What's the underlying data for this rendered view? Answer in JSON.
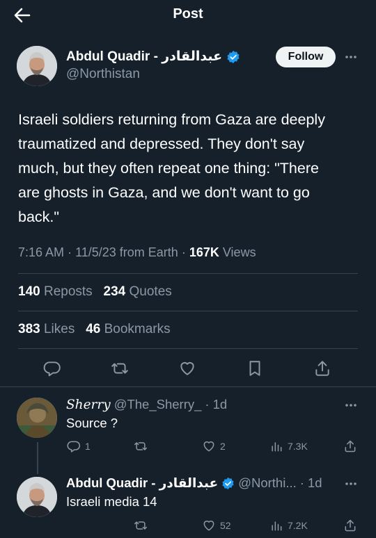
{
  "header": {
    "title": "Post"
  },
  "post": {
    "author_name": "Abdul Quadir - عبدالقادر",
    "author_handle": "@Northistan",
    "follow_label": "Follow",
    "text_lines": [
      "Israeli soldiers returning from Gaza are deeply",
      "traumatized and depressed. They don't say",
      "much, but they often repeat one thing: \"There",
      "are ghosts in Gaza, and we don't want to go",
      "back.\""
    ],
    "time": "7:16 AM",
    "date": "11/5/23 from Earth",
    "views_count": "167K",
    "views_label": "Views",
    "reposts_count": "140",
    "reposts_label": "Reposts",
    "quotes_count": "234",
    "quotes_label": "Quotes",
    "likes_count": "383",
    "likes_label": "Likes",
    "bookmarks_count": "46",
    "bookmarks_label": "Bookmarks"
  },
  "replies": [
    {
      "name": "Sherry",
      "handle": "@The_Sherry_",
      "age": "1d",
      "text": "Source ?",
      "reply_count": "1",
      "repost_count": "",
      "like_count": "2",
      "view_count": "7.3K"
    },
    {
      "name": "Abdul Quadir - عبدالقادر",
      "handle": "@Northi...",
      "age": "1d",
      "text": "Israeli media 14",
      "reply_count": "",
      "repost_count": "",
      "like_count": "52",
      "view_count": "7.2K"
    }
  ],
  "colors": {
    "background": "#15202b",
    "muted": "#8b98a5",
    "verified": "#1d9bf0",
    "divider": "#38444d"
  },
  "icons": [
    "back-arrow-icon",
    "verified-badge-icon",
    "more-icon",
    "reply-icon",
    "repost-icon",
    "like-icon",
    "bookmark-icon",
    "share-icon",
    "views-icon"
  ]
}
